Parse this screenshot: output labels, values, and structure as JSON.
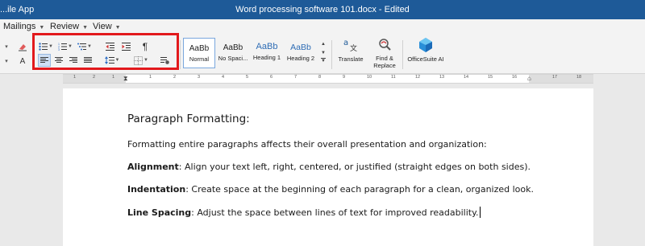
{
  "window": {
    "app_label": "...ile App",
    "title": "Word processing software 101.docx - Edited"
  },
  "menu": {
    "items": [
      {
        "label": "Mailings"
      },
      {
        "label": "Review"
      },
      {
        "label": "View"
      }
    ]
  },
  "ribbon": {
    "paragraph_group_highlight_color": "#e2191c",
    "pilcrow": "¶",
    "styles": [
      {
        "sample": "AaBb",
        "name": "Normal"
      },
      {
        "sample": "AaBb",
        "name": "No Spaci..."
      },
      {
        "sample": "AaBb",
        "name": "Heading 1"
      },
      {
        "sample": "AaBb",
        "name": "Heading 2"
      }
    ],
    "translate_label": "Translate",
    "find_label_1": "Find &",
    "find_label_2": "Replace",
    "ai_label": "OfficeSuite AI"
  },
  "ruler": {
    "labels_left": [
      "1",
      "2",
      "1"
    ],
    "labels_right": [
      "1",
      "2",
      "3",
      "4",
      "5",
      "6",
      "7",
      "8",
      "9",
      "10",
      "11",
      "12",
      "13",
      "14",
      "15",
      "16",
      "17",
      "18"
    ]
  },
  "document": {
    "heading": "Paragraph Formatting:",
    "intro": "Formatting entire paragraphs affects their overall presentation and organization:",
    "items": [
      {
        "term": "Alignment",
        "text": ": Align your text left, right, centered, or justified (straight edges on both sides)."
      },
      {
        "term": "Indentation",
        "text": ": Create space at the beginning of each paragraph for a clean, organized look."
      },
      {
        "term": "Line Spacing",
        "text": ": Adjust the space between lines of text for improved readability."
      }
    ]
  }
}
